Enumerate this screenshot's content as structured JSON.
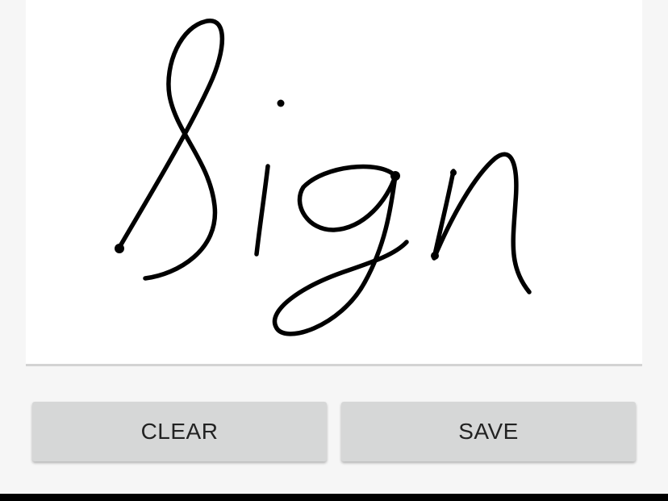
{
  "buttons": {
    "clear_label": "CLEAR",
    "save_label": "SAVE"
  },
  "signature": {
    "handwritten_text": "Sign",
    "ink_color": "#000000"
  },
  "colors": {
    "pad_background": "#ffffff",
    "button_background": "#d6d7d7",
    "button_text": "#222222",
    "screen_background": "#f6f6f6"
  }
}
